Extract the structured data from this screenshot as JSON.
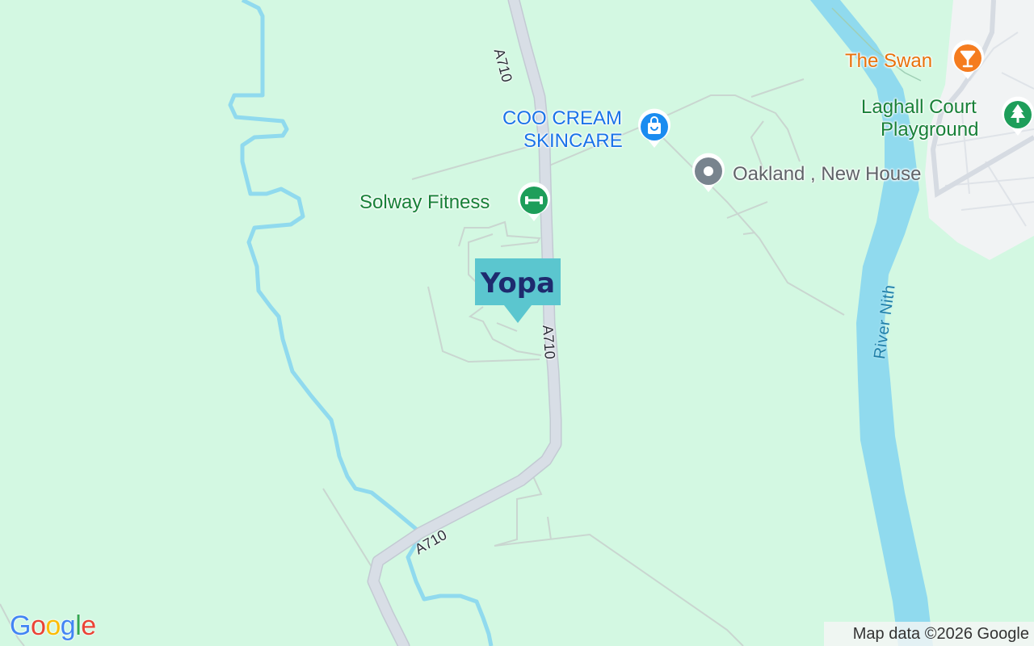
{
  "map": {
    "pois": [
      {
        "id": "the-swan",
        "label": "The Swan",
        "color": "#e8710a",
        "icon": "cocktail-icon"
      },
      {
        "id": "laghall",
        "label_line1": "Laghall Court",
        "label_line2": "Playground",
        "color": "#188038",
        "icon": "tree-icon"
      },
      {
        "id": "coo-cream",
        "label_line1": "COO CREAM",
        "label_line2": "SKINCARE",
        "color": "#1a73e8",
        "icon": "shopping-bag-icon"
      },
      {
        "id": "oakland",
        "label": "Oakland , New House",
        "color": "#5f6368",
        "icon": "dot-icon"
      },
      {
        "id": "solway",
        "label": "Solway Fitness",
        "color": "#188038",
        "icon": "dumbbell-icon"
      }
    ],
    "road_labels": [
      "A710",
      "A710",
      "A710"
    ],
    "water_label": "River Nith",
    "marker": {
      "brand": "Yopa",
      "logo_text": "Yopa",
      "color": "#5bc6cf",
      "text_color": "#1e2a6e"
    },
    "google_logo": [
      "G",
      "o",
      "o",
      "g",
      "l",
      "e"
    ],
    "attribution": "Map data ©2026 Google"
  },
  "colors": {
    "land": "#d3f8e2",
    "water": "#90daee",
    "road": "#d8dee6",
    "road_edge": "#c3cad3",
    "minor_road": "#c9d6d0",
    "urban": "#f1f3f4"
  }
}
